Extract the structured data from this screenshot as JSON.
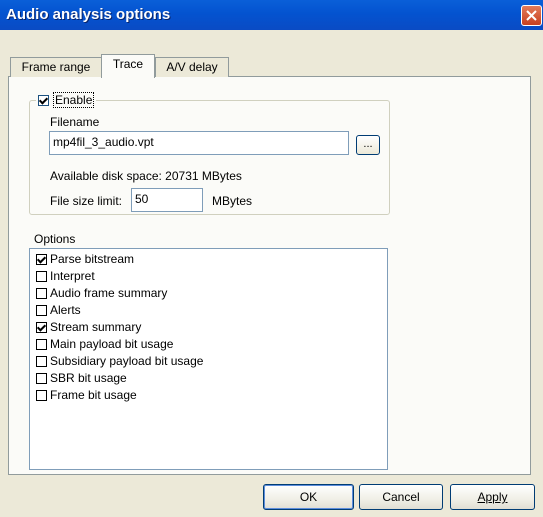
{
  "window": {
    "title": "Audio analysis options"
  },
  "tabs": [
    {
      "label": "Frame range"
    },
    {
      "label": "Trace"
    },
    {
      "label": "A/V delay"
    }
  ],
  "trace": {
    "enable_label": "Enable",
    "enable_checked": true,
    "filename_label": "Filename",
    "filename_value": "mp4fil_3_audio.vpt",
    "browse_label": "...",
    "disk_space_text": "Available disk space: 20731 MBytes",
    "size_limit_label": "File size limit:",
    "size_limit_value": "50",
    "size_limit_unit": "MBytes"
  },
  "options": {
    "label": "Options",
    "items": [
      {
        "label": "Parse bitstream",
        "checked": true
      },
      {
        "label": "Interpret",
        "checked": false
      },
      {
        "label": "Audio frame summary",
        "checked": false
      },
      {
        "label": "Alerts",
        "checked": false
      },
      {
        "label": "Stream summary",
        "checked": true
      },
      {
        "label": "Main payload bit usage",
        "checked": false
      },
      {
        "label": "Subsidiary payload bit usage",
        "checked": false
      },
      {
        "label": "SBR bit usage",
        "checked": false
      },
      {
        "label": "Frame bit usage",
        "checked": false
      }
    ]
  },
  "buttons": {
    "ok": "OK",
    "cancel": "Cancel",
    "apply": "Apply"
  }
}
